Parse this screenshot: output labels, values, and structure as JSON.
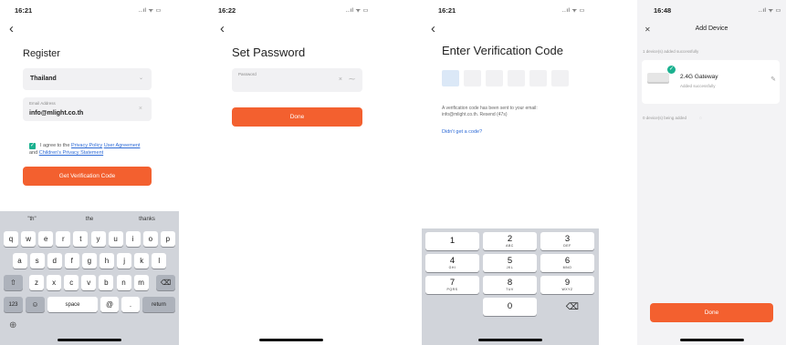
{
  "screen1": {
    "time": "16:21",
    "status_icons": "..ıl ᯤ ▭",
    "back": "‹",
    "title": "Register",
    "country": "Thailand",
    "email_label": "Email Address",
    "email_value": "info@mlight.co.th",
    "agree_prefix": "I agree to the",
    "privacy_link": "Privacy Policy",
    "user_link": "User Agreement",
    "and_text": "and",
    "children_link": "Children's Privacy Statement",
    "button": "Get Verification Code",
    "suggestions": [
      "\"th\"",
      "the",
      "thanks"
    ],
    "row1": [
      "q",
      "w",
      "e",
      "r",
      "t",
      "y",
      "u",
      "i",
      "o",
      "p"
    ],
    "row2": [
      "a",
      "s",
      "d",
      "f",
      "g",
      "h",
      "j",
      "k",
      "l"
    ],
    "row3": [
      "z",
      "x",
      "c",
      "v",
      "b",
      "n",
      "m"
    ],
    "shift": "⇧",
    "delete": "⌫",
    "num_key": "123",
    "emoji": "☺",
    "space": "space",
    "at": "@",
    "dot": ".",
    "return": "return",
    "globe": "⊕"
  },
  "screen2": {
    "time": "16:22",
    "status_icons": "..ıl ᯤ ▭",
    "back": "‹",
    "title": "Set Password",
    "password_label": "Password",
    "clear": "×",
    "eye": "⁓",
    "button": "Done"
  },
  "screen3": {
    "time": "16:21",
    "status_icons": "..ıl ᯤ ▭",
    "back": "‹",
    "title": "Enter Verification Code",
    "info": "A verification code has been sent to your email: info@mlight.co.th. Resend (47s)",
    "no_code": "Didn't get a code?",
    "keys": [
      {
        "n": "1",
        "l": ""
      },
      {
        "n": "2",
        "l": "ABC"
      },
      {
        "n": "3",
        "l": "DEF"
      },
      {
        "n": "4",
        "l": "GHI"
      },
      {
        "n": "5",
        "l": "JKL"
      },
      {
        "n": "6",
        "l": "MNO"
      },
      {
        "n": "7",
        "l": "PQRS"
      },
      {
        "n": "8",
        "l": "TUV"
      },
      {
        "n": "9",
        "l": "WXYZ"
      },
      {
        "n": "0",
        "l": ""
      }
    ],
    "delete": "⌫"
  },
  "screen4": {
    "time": "16:48",
    "status_icons": "..ıl ᯤ ▭",
    "close": "✕",
    "title": "Add Device",
    "added_label": "1 device(s) added successfully",
    "device_name": "2.4G Gateway",
    "device_status": "Added successfully",
    "edit": "✎",
    "pending_label": "0 device(s) being added",
    "button": "Done"
  },
  "colors": {
    "accent": "#f3602f",
    "check": "#1bb18f",
    "link": "#2e6bd6"
  }
}
